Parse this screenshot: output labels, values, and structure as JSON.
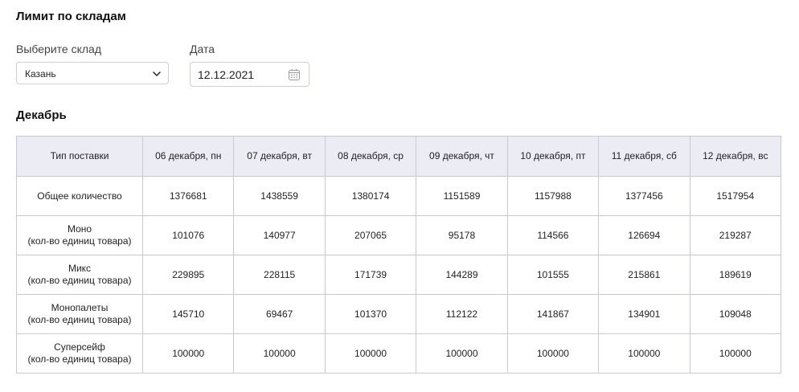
{
  "page": {
    "title": "Лимит по складам"
  },
  "filters": {
    "warehouse_label": "Выберите склад",
    "warehouse_value": "Казань",
    "date_label": "Дата",
    "date_value": "12.12.2021"
  },
  "month": {
    "title": "Декабрь"
  },
  "table": {
    "headers": [
      "Тип поставки",
      "06 декабря, пн",
      "07 декабря, вт",
      "08 декабря, ср",
      "09 декабря, чт",
      "10 декабря, пт",
      "11 декабря, сб",
      "12 декабря, вс"
    ],
    "rows": [
      {
        "type": "Общее количество",
        "sub": "",
        "values": [
          "1376681",
          "1438559",
          "1380174",
          "1151589",
          "1157988",
          "1377456",
          "1517954"
        ]
      },
      {
        "type": "Моно",
        "sub": "(кол-во единиц товара)",
        "values": [
          "101076",
          "140977",
          "207065",
          "95178",
          "114566",
          "126694",
          "219287"
        ]
      },
      {
        "type": "Микс",
        "sub": "(кол-во единиц товара)",
        "values": [
          "229895",
          "228115",
          "171739",
          "144289",
          "101555",
          "215861",
          "189619"
        ]
      },
      {
        "type": "Монопалеты",
        "sub": "(кол-во единиц товара)",
        "values": [
          "145710",
          "69467",
          "101370",
          "112122",
          "141867",
          "134901",
          "109048"
        ]
      },
      {
        "type": "Суперсейф",
        "sub": "(кол-во единиц товара)",
        "values": [
          "100000",
          "100000",
          "100000",
          "100000",
          "100000",
          "100000",
          "100000"
        ]
      }
    ]
  },
  "icons": {
    "select_chevron": "chevron-down-icon",
    "date_picker": "calendar-icon"
  },
  "colors": {
    "header_bg": "#ececf4",
    "border": "#c9c9d3",
    "text": "#1f1f1f"
  }
}
